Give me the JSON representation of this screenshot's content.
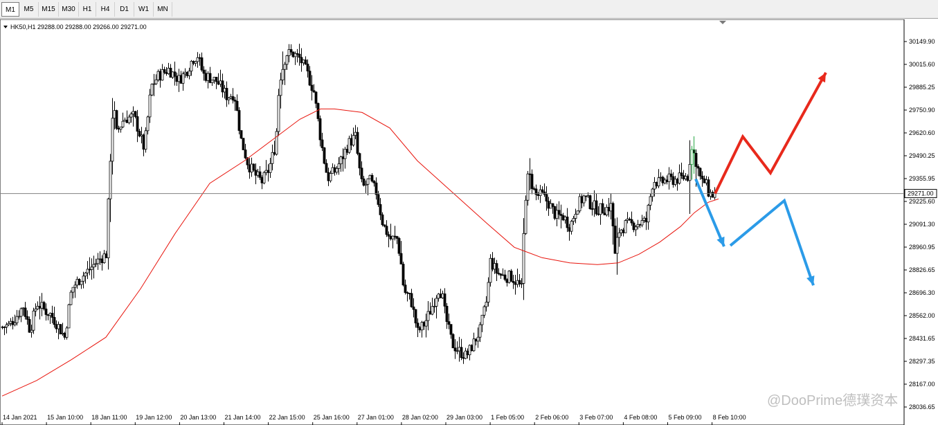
{
  "toolbar": {
    "timeframes": [
      "M1",
      "M5",
      "M15",
      "M30",
      "H1",
      "H4",
      "D1",
      "W1",
      "MN"
    ],
    "active": "M1"
  },
  "header": {
    "symbol_line": "HK50,H1  29288.00 29288.00 29266.00 29271.00"
  },
  "watermark": "@DooPrime德璞资本",
  "colors": {
    "bull_candle": "#ffffff",
    "bear_candle": "#000000",
    "moving_average": "#e8140c",
    "bull_forecast": "#e8291c",
    "bear_forecast": "#2b9be8",
    "price_line": "#808080",
    "price_label_bg": "#ffffff"
  },
  "chart_data": {
    "type": "candlestick",
    "symbol": "HK50",
    "timeframe": "H1",
    "current_price": 29271.0,
    "current_price_label": "29271.00",
    "ylim": [
      28036.65,
      30228.0
    ],
    "y_ticks": [
      "30149.90",
      "30015.60",
      "29885.25",
      "29750.90",
      "29620.60",
      "29490.25",
      "29355.95",
      "29225.60",
      "29091.30",
      "28960.95",
      "28826.65",
      "28696.30",
      "28562.00",
      "28431.65",
      "28297.35",
      "28167.00",
      "28036.65"
    ],
    "x_ticks": [
      "14 Jan 2021",
      "15 Jan 10:00",
      "18 Jan 11:00",
      "19 Jan 12:00",
      "20 Jan 13:00",
      "21 Jan 14:00",
      "22 Jan 15:00",
      "25 Jan 16:00",
      "27 Jan 01:00",
      "28 Jan 02:00",
      "29 Jan 03:00",
      "1 Feb 05:00",
      "2 Feb 06:00",
      "3 Feb 07:00",
      "4 Feb 08:00",
      "5 Feb 09:00",
      "8 Feb 10:00"
    ],
    "candle_anchor_values": [
      [
        0,
        28500
      ],
      [
        10,
        28510
      ],
      [
        20,
        28560
      ],
      [
        30,
        28620
      ],
      [
        40,
        28480
      ],
      [
        50,
        28640
      ],
      [
        60,
        28600
      ],
      [
        70,
        28570
      ],
      [
        80,
        28510
      ],
      [
        90,
        28440
      ],
      [
        100,
        28720
      ],
      [
        110,
        28770
      ],
      [
        120,
        28810
      ],
      [
        130,
        28850
      ],
      [
        140,
        28890
      ],
      [
        150,
        28920
      ],
      [
        155,
        29400
      ],
      [
        160,
        29800
      ],
      [
        165,
        29620
      ],
      [
        175,
        29700
      ],
      [
        190,
        29720
      ],
      [
        205,
        29530
      ],
      [
        215,
        29890
      ],
      [
        225,
        29950
      ],
      [
        240,
        29990
      ],
      [
        255,
        29930
      ],
      [
        265,
        29970
      ],
      [
        275,
        30050
      ],
      [
        282,
        30070
      ],
      [
        290,
        29960
      ],
      [
        300,
        29940
      ],
      [
        310,
        29920
      ],
      [
        325,
        29830
      ],
      [
        335,
        29850
      ],
      [
        345,
        29580
      ],
      [
        355,
        29440
      ],
      [
        365,
        29380
      ],
      [
        375,
        29340
      ],
      [
        385,
        29410
      ],
      [
        395,
        29560
      ],
      [
        400,
        29920
      ],
      [
        410,
        30080
      ],
      [
        420,
        30080
      ],
      [
        430,
        30050
      ],
      [
        440,
        29970
      ],
      [
        450,
        29860
      ],
      [
        460,
        29580
      ],
      [
        465,
        29460
      ],
      [
        470,
        29360
      ],
      [
        480,
        29400
      ],
      [
        490,
        29470
      ],
      [
        500,
        29560
      ],
      [
        510,
        29600
      ],
      [
        515,
        29430
      ],
      [
        520,
        29300
      ],
      [
        530,
        29350
      ],
      [
        540,
        29280
      ],
      [
        550,
        29090
      ],
      [
        560,
        29010
      ],
      [
        570,
        29010
      ],
      [
        575,
        28900
      ],
      [
        580,
        28710
      ],
      [
        590,
        28660
      ],
      [
        600,
        28470
      ],
      [
        610,
        28520
      ],
      [
        620,
        28610
      ],
      [
        630,
        28720
      ],
      [
        635,
        28690
      ],
      [
        640,
        28560
      ],
      [
        650,
        28400
      ],
      [
        660,
        28360
      ],
      [
        670,
        28330
      ],
      [
        680,
        28400
      ],
      [
        690,
        28480
      ],
      [
        700,
        28660
      ],
      [
        705,
        28880
      ],
      [
        715,
        28810
      ],
      [
        725,
        28790
      ],
      [
        735,
        28790
      ],
      [
        745,
        28750
      ],
      [
        750,
        28720
      ],
      [
        755,
        29230
      ],
      [
        760,
        29390
      ],
      [
        770,
        29260
      ],
      [
        780,
        29260
      ],
      [
        790,
        29210
      ],
      [
        800,
        29140
      ],
      [
        810,
        29140
      ],
      [
        820,
        29080
      ],
      [
        830,
        29200
      ],
      [
        840,
        29250
      ],
      [
        850,
        29210
      ],
      [
        860,
        29180
      ],
      [
        870,
        29180
      ],
      [
        880,
        29200
      ],
      [
        885,
        28910
      ],
      [
        890,
        29050
      ],
      [
        900,
        29090
      ],
      [
        910,
        29090
      ],
      [
        920,
        29100
      ],
      [
        930,
        29110
      ],
      [
        940,
        29350
      ],
      [
        950,
        29330
      ],
      [
        960,
        29350
      ],
      [
        970,
        29350
      ],
      [
        980,
        29360
      ],
      [
        990,
        29370
      ],
      [
        995,
        29530
      ],
      [
        1000,
        29490
      ],
      [
        1005,
        29410
      ],
      [
        1010,
        29330
      ],
      [
        1015,
        29340
      ],
      [
        1020,
        29280
      ],
      [
        1025,
        29260
      ],
      [
        1030,
        29271
      ]
    ],
    "moving_average": [
      [
        0,
        28100
      ],
      [
        50,
        28190
      ],
      [
        100,
        28310
      ],
      [
        150,
        28440
      ],
      [
        200,
        28720
      ],
      [
        250,
        29040
      ],
      [
        300,
        29330
      ],
      [
        350,
        29460
      ],
      [
        400,
        29610
      ],
      [
        430,
        29700
      ],
      [
        460,
        29760
      ],
      [
        480,
        29760
      ],
      [
        520,
        29740
      ],
      [
        560,
        29650
      ],
      [
        600,
        29460
      ],
      [
        650,
        29280
      ],
      [
        700,
        29100
      ],
      [
        740,
        28960
      ],
      [
        780,
        28900
      ],
      [
        820,
        28870
      ],
      [
        860,
        28860
      ],
      [
        890,
        28870
      ],
      [
        920,
        28920
      ],
      [
        950,
        28990
      ],
      [
        980,
        29080
      ],
      [
        1000,
        29160
      ],
      [
        1020,
        29220
      ],
      [
        1035,
        29240
      ]
    ],
    "forecast_paths": [
      {
        "color": "bull",
        "points": [
          [
            1030,
            29271
          ],
          [
            1070,
            29600
          ],
          [
            1110,
            29390
          ],
          [
            1190,
            29970
          ]
        ]
      },
      {
        "color": "bear",
        "points": [
          [
            1002,
            29355
          ],
          [
            1043,
            28965
          ]
        ]
      },
      {
        "color": "bear",
        "points": [
          [
            1052,
            28970
          ],
          [
            1130,
            29230
          ],
          [
            1172,
            28740
          ]
        ]
      }
    ]
  }
}
